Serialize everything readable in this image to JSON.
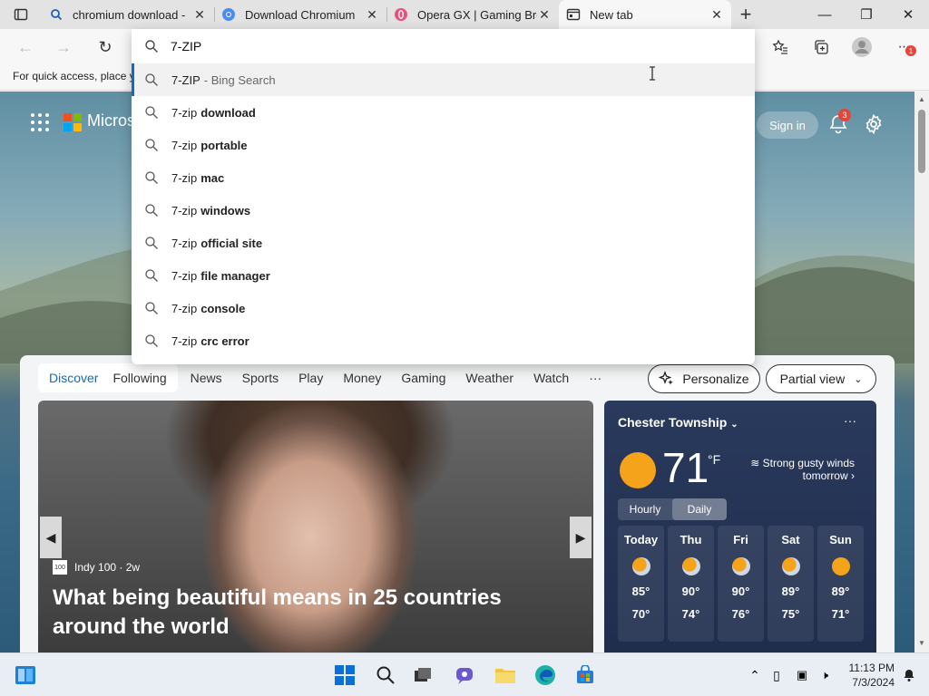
{
  "tabs": [
    {
      "title": "chromium download -",
      "icon": "search-icon"
    },
    {
      "title": "Download Chromium",
      "icon": "chromium-icon"
    },
    {
      "title": "Opera GX | Gaming Bro",
      "icon": "opera-gx-icon"
    },
    {
      "title": "New tab",
      "icon": "newtab-icon"
    }
  ],
  "favorites_bar": {
    "text": "For quick access, place y"
  },
  "omnibox": {
    "value": "7-ZIP",
    "suggestions": [
      {
        "prefix": "7-ZIP",
        "bold": "",
        "hint": "- Bing Search"
      },
      {
        "prefix": "7-zip",
        "bold": "download",
        "hint": ""
      },
      {
        "prefix": "7-zip",
        "bold": "portable",
        "hint": ""
      },
      {
        "prefix": "7-zip",
        "bold": "mac",
        "hint": ""
      },
      {
        "prefix": "7-zip",
        "bold": "windows",
        "hint": ""
      },
      {
        "prefix": "7-zip",
        "bold": "official site",
        "hint": ""
      },
      {
        "prefix": "7-zip",
        "bold": "file manager",
        "hint": ""
      },
      {
        "prefix": "7-zip",
        "bold": "console",
        "hint": ""
      },
      {
        "prefix": "7-zip",
        "bold": "crc error",
        "hint": ""
      }
    ]
  },
  "toolbar": {
    "notification_count": "1"
  },
  "header": {
    "brand": "Micros",
    "signin": "Sign in",
    "bell_count": "3"
  },
  "feed": {
    "pill_tabs": [
      "Discover",
      "Following"
    ],
    "nav_links": [
      "News",
      "Sports",
      "Play",
      "Money",
      "Gaming",
      "Weather",
      "Watch",
      "···"
    ],
    "personalize": "Personalize",
    "partial_view": "Partial view"
  },
  "hero": {
    "source": "Indy 100 · 2w",
    "source_logo": "100",
    "headline": "What being beautiful means in 25 countries around the world"
  },
  "weather": {
    "location": "Chester Township",
    "temp": "71",
    "unit": "°F",
    "wind": "Strong gusty winds tomorrow",
    "tabs": [
      "Hourly",
      "Daily"
    ],
    "days": [
      {
        "day": "Today",
        "high": "85°",
        "low": "70°",
        "icon": "partly-cloudy-icon"
      },
      {
        "day": "Thu",
        "high": "90°",
        "low": "74°",
        "icon": "partly-sunny-icon"
      },
      {
        "day": "Fri",
        "high": "90°",
        "low": "76°",
        "icon": "rain-cloud-icon"
      },
      {
        "day": "Sat",
        "high": "89°",
        "low": "75°",
        "icon": "partly-cloudy-icon"
      },
      {
        "day": "Sun",
        "high": "89°",
        "low": "71°",
        "icon": "sun-icon"
      }
    ]
  },
  "clock": {
    "time": "11:13 PM",
    "date": "7/3/2024"
  },
  "colors": {
    "accent": "#0f6cbd",
    "weather_bg": "#2a3a5c",
    "badge": "#e5453a"
  }
}
